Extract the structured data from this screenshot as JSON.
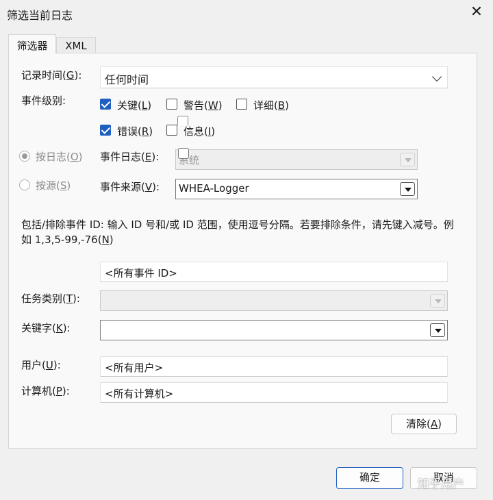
{
  "window": {
    "title": "筛选当前日志",
    "close_glyph": "✕"
  },
  "tabs": [
    {
      "label": "筛选器"
    },
    {
      "label": "XML"
    }
  ],
  "logged": {
    "label": "记录时间(",
    "key": "G",
    "suffix": "):",
    "value": "任何时间"
  },
  "level": {
    "label": "事件级别:",
    "critical": {
      "label": "关键(",
      "key": "L",
      "suffix": ")",
      "checked": true
    },
    "warning": {
      "label": "警告(",
      "key": "W",
      "suffix": ")",
      "checked": false
    },
    "verbose": {
      "label": "详细(",
      "key": "B",
      "suffix": ")",
      "checked": false
    },
    "error": {
      "label": "错误(",
      "key": "R",
      "suffix": ")",
      "checked": true
    },
    "information": {
      "label": "信息(",
      "key": "I",
      "suffix": ")",
      "checked": false
    }
  },
  "by_log": {
    "label": "按日志(",
    "key": "O",
    "suffix": ")"
  },
  "by_source": {
    "label": "按源(",
    "key": "S",
    "suffix": ")"
  },
  "event_logs": {
    "label": "事件日志(",
    "key": "E",
    "suffix": "):",
    "value": "系统"
  },
  "event_sources": {
    "label": "事件来源(",
    "key": "V",
    "suffix": "):",
    "value": "WHEA-Logger"
  },
  "description": {
    "text": "包括/排除事件 ID: 输入 ID 号和/或 ID 范围，使用逗号分隔。若要排除条件，请先键入减号。例如 1,3,5-99,-76(",
    "key": "N",
    "suffix": ")"
  },
  "event_ids": {
    "value": "<所有事件 ID>"
  },
  "task_category": {
    "label": "任务类别(",
    "key": "T",
    "suffix": "):",
    "value": ""
  },
  "keywords": {
    "label": "关键字(",
    "key": "K",
    "suffix": "):",
    "value": ""
  },
  "user": {
    "label": "用户(",
    "key": "U",
    "suffix": "):",
    "value": "<所有用户>"
  },
  "computer": {
    "label": "计算机(",
    "key": "P",
    "suffix": "):",
    "value": "<所有计算机>"
  },
  "clear_button": {
    "label": "清除(",
    "key": "A",
    "suffix": ")"
  },
  "ok_button": {
    "label": "确定"
  },
  "cancel_button": {
    "label": "取消"
  },
  "watermark": {
    "text": "知乎用户"
  },
  "colors": {
    "accent": "#1f5fbf",
    "background": "#f0f0f0",
    "panel": "#f9f9f9"
  }
}
